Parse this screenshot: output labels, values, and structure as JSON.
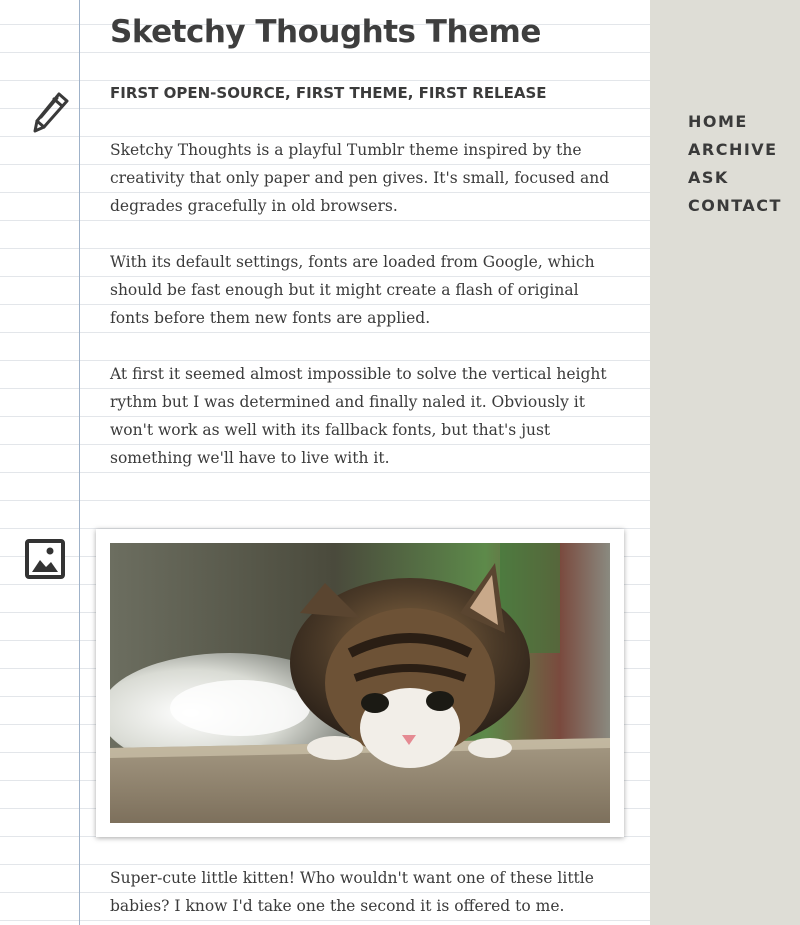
{
  "post": {
    "title": "Sketchy Thoughts Theme",
    "subtitle": "FIRST OPEN-SOURCE, FIRST THEME, FIRST RELEASE",
    "paragraphs": [
      "Sketchy Thoughts is a playful Tumblr theme inspired by the creativity that only paper and pen gives. It's small, focused and degrades gracefully in old browsers.",
      "With its default settings, fonts are loaded from Google, which should be fast enough but it might create a flash of original fonts before them new fonts are applied.",
      "At first it seemed almost impossible to solve the vertical height rythm but I was determined and finally naled it. Obviously it won't work as well with its fallback fonts, but that's just something we'll have to live with it."
    ],
    "text_post_icon": "pencil-icon"
  },
  "photo_post": {
    "icon": "photo-icon",
    "image": "kitten-photo",
    "caption": "Super-cute little kitten! Who wouldn't want one of these little babies? I know I'd take one the second it is offered to me."
  },
  "nav": {
    "items": [
      {
        "label": "HOME"
      },
      {
        "label": "ARCHIVE"
      },
      {
        "label": "ASK"
      },
      {
        "label": "CONTACT"
      }
    ]
  },
  "colors": {
    "sidebar_bg": "#deddd6",
    "margin_line": "#9fb2c9",
    "rule_line": "#e3e6ea",
    "text": "#3b3b3b"
  }
}
